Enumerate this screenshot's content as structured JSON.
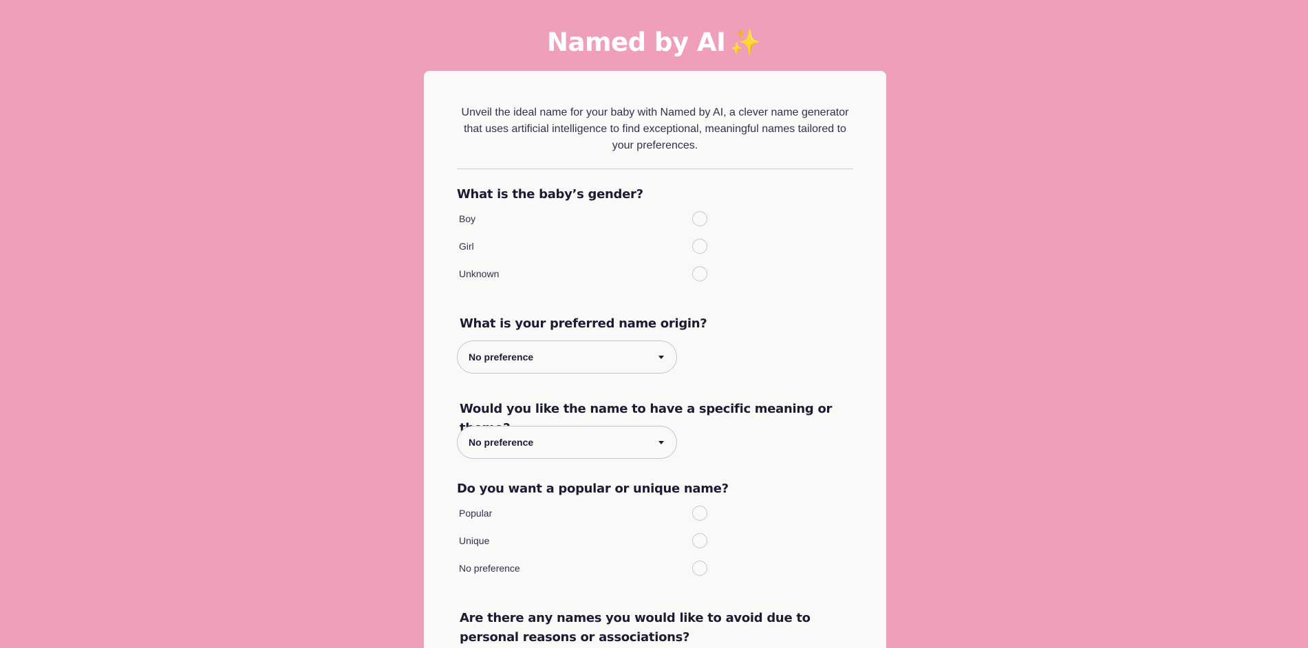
{
  "header": {
    "title": "Named by AI",
    "sparkle": "✨"
  },
  "intro": {
    "text": "Unveil the ideal name for your baby with Named by AI, a clever name generator that uses artificial intelligence to find exceptional, meaningful names tailored to your preferences."
  },
  "gender": {
    "question": "What is the baby’s gender?",
    "options": [
      "Boy",
      "Girl",
      "Unknown"
    ]
  },
  "origin": {
    "question": "What is your preferred name origin?",
    "selected": "No preference"
  },
  "meaning": {
    "question": "Would you like the name to have a specific meaning or theme?",
    "selected": "No preference"
  },
  "popularity": {
    "question": "Do you want a popular or unique name?",
    "options": [
      "Popular",
      "Unique",
      "No preference"
    ]
  },
  "avoid": {
    "question": "Are there any names you would like to avoid due to personal reasons or associations?"
  }
}
